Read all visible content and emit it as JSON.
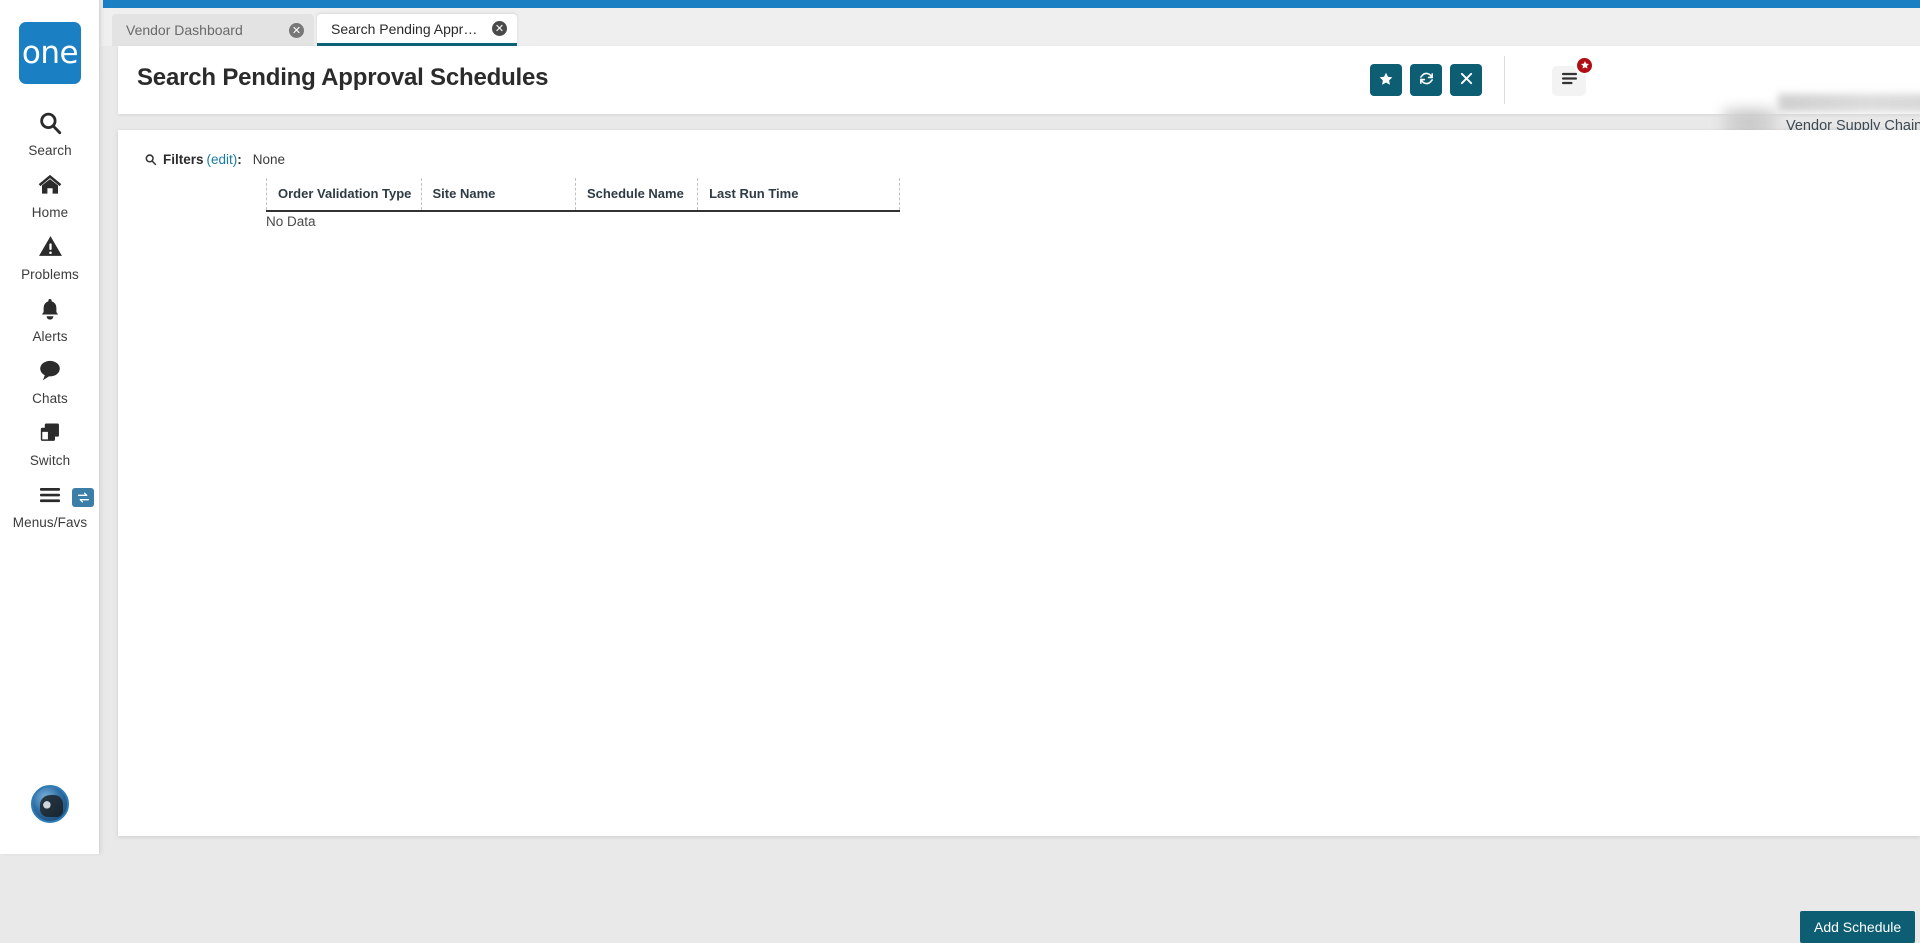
{
  "brand": {
    "logo_text": "one",
    "accent_blue": "#1b7fc4",
    "accent_teal": "#0d5e73",
    "badge_red": "#b00d14",
    "link_blue": "#1a7ba8"
  },
  "sidebar": {
    "items": [
      {
        "label": "Search",
        "icon": "search-icon"
      },
      {
        "label": "Home",
        "icon": "home-icon"
      },
      {
        "label": "Problems",
        "icon": "warning-triangle-icon"
      },
      {
        "label": "Alerts",
        "icon": "bell-icon"
      },
      {
        "label": "Chats",
        "icon": "chat-bubble-icon"
      },
      {
        "label": "Switch",
        "icon": "windows-stack-icon"
      },
      {
        "label": "Menus/Favs",
        "icon": "hamburger-icon"
      }
    ],
    "switch_badge_icon": "swap-arrows-icon",
    "avatar_icon": "user-avatar-icon"
  },
  "tabs": [
    {
      "label": "Vendor Dashboard",
      "active": false,
      "close_icon": "close-circle-icon"
    },
    {
      "label": "Search Pending Approval Schedu...",
      "active": true,
      "close_icon": "close-circle-icon"
    }
  ],
  "header": {
    "title": "Search Pending Approval Schedules",
    "buttons": [
      {
        "name": "favorite-button",
        "icon": "star-icon"
      },
      {
        "name": "refresh-button",
        "icon": "refresh-icon"
      },
      {
        "name": "close-button",
        "icon": "x-icon"
      }
    ],
    "menu_icon": "hamburger-menu-icon",
    "menu_badge_icon": "star-icon",
    "user_role": "Vendor Supply Chain Admin",
    "caret_icon": "chevron-down-icon"
  },
  "filters": {
    "icon": "search-icon",
    "label": "Filters",
    "edit_label": "(edit)",
    "colon": ":",
    "value": "None"
  },
  "grid": {
    "columns": [
      "Order Validation Type",
      "Site Name",
      "Schedule Name",
      "Last Run Time"
    ],
    "rows": [],
    "empty_text": "No Data"
  },
  "footer": {
    "add_label": "Add Schedule"
  }
}
